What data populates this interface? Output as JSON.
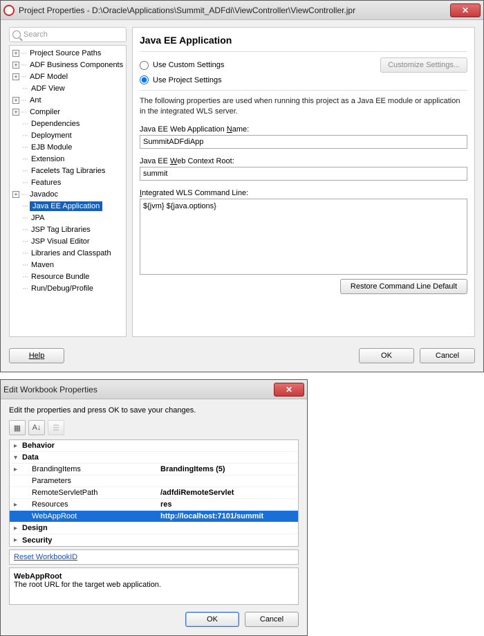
{
  "dialog1": {
    "title": "Project Properties - D:\\Oracle\\Applications\\Summit_ADFdi\\ViewController\\ViewController.jpr",
    "search_placeholder": "Search",
    "tree": [
      {
        "id": "project-source-paths",
        "label": "Project Source Paths",
        "expandable": true
      },
      {
        "id": "adf-business-components",
        "label": "ADF Business Components",
        "expandable": true
      },
      {
        "id": "adf-model",
        "label": "ADF Model",
        "expandable": true
      },
      {
        "id": "adf-view",
        "label": "ADF View",
        "expandable": false,
        "child": true
      },
      {
        "id": "ant",
        "label": "Ant",
        "expandable": true
      },
      {
        "id": "compiler",
        "label": "Compiler",
        "expandable": true
      },
      {
        "id": "dependencies",
        "label": "Dependencies",
        "expandable": false,
        "child": true
      },
      {
        "id": "deployment",
        "label": "Deployment",
        "expandable": false,
        "child": true
      },
      {
        "id": "ejb-module",
        "label": "EJB Module",
        "expandable": false,
        "child": true
      },
      {
        "id": "extension",
        "label": "Extension",
        "expandable": false,
        "child": true
      },
      {
        "id": "facelets-tag-libraries",
        "label": "Facelets Tag Libraries",
        "expandable": false,
        "child": true
      },
      {
        "id": "features",
        "label": "Features",
        "expandable": false,
        "child": true
      },
      {
        "id": "javadoc",
        "label": "Javadoc",
        "expandable": true
      },
      {
        "id": "java-ee-application",
        "label": "Java EE Application",
        "expandable": false,
        "child": true,
        "selected": true
      },
      {
        "id": "jpa",
        "label": "JPA",
        "expandable": false,
        "child": true
      },
      {
        "id": "jsp-tag-libraries",
        "label": "JSP Tag Libraries",
        "expandable": false,
        "child": true
      },
      {
        "id": "jsp-visual-editor",
        "label": "JSP Visual Editor",
        "expandable": false,
        "child": true
      },
      {
        "id": "libraries-and-classpath",
        "label": "Libraries and Classpath",
        "expandable": false,
        "child": true
      },
      {
        "id": "maven",
        "label": "Maven",
        "expandable": false,
        "child": true
      },
      {
        "id": "resource-bundle",
        "label": "Resource Bundle",
        "expandable": false,
        "child": true
      },
      {
        "id": "run-debug-profile",
        "label": "Run/Debug/Profile",
        "expandable": false,
        "child": true
      }
    ],
    "page_title": "Java EE Application",
    "use_custom_label": "Use Custom Settings",
    "use_project_label": "Use Project Settings",
    "customize_btn": "Customize Settings...",
    "description": "The following properties are used when running this project as a Java EE module or application in the integrated WLS server.",
    "appname_label_pre": "Java EE Web Application ",
    "appname_label_u": "N",
    "appname_label_post": "ame:",
    "appname_value": "SummitADFdiApp",
    "context_label_pre": "Java EE ",
    "context_label_u": "W",
    "context_label_post": "eb Context Root:",
    "context_value": "summit",
    "cmdline_label_u": "I",
    "cmdline_label_post": "ntegrated WLS Command Line:",
    "cmdline_value": "${jvm} ${java.options}",
    "restore_btn": "Restore Command Line Default",
    "help_btn": "Help",
    "ok_btn": "OK",
    "cancel_btn": "Cancel"
  },
  "dialog2": {
    "title": "Edit Workbook Properties",
    "intro": "Edit the properties and press OK to save your changes.",
    "toolbar": {
      "categorized_icon": "▦",
      "alpha_icon": "A↓",
      "pages_icon": "☰"
    },
    "rows": [
      {
        "kind": "cat",
        "arrow": "right",
        "key": "Behavior"
      },
      {
        "kind": "cat",
        "arrow": "down",
        "key": "Data"
      },
      {
        "kind": "prop",
        "arrow": "right",
        "indent": 1,
        "key": "BrandingItems",
        "val": "BrandingItems (5)",
        "bold": true
      },
      {
        "kind": "prop",
        "indent": 1,
        "key": "Parameters",
        "val": ""
      },
      {
        "kind": "prop",
        "indent": 1,
        "key": "RemoteServletPath",
        "val": "/adfdiRemoteServlet",
        "bold": true
      },
      {
        "kind": "prop",
        "arrow": "right",
        "indent": 1,
        "key": "Resources",
        "val": "res",
        "bold": true
      },
      {
        "kind": "prop",
        "indent": 1,
        "key": "WebAppRoot",
        "val": "http://localhost:7101/summit",
        "bold": true,
        "selected": true
      },
      {
        "kind": "cat",
        "arrow": "right",
        "key": "Design"
      },
      {
        "kind": "cat",
        "arrow": "right",
        "key": "Security"
      }
    ],
    "reset_link": "Reset WorkbookID",
    "help_name": "WebAppRoot",
    "help_text": "The root URL for the target web application.",
    "ok_btn": "OK",
    "cancel_btn": "Cancel"
  }
}
